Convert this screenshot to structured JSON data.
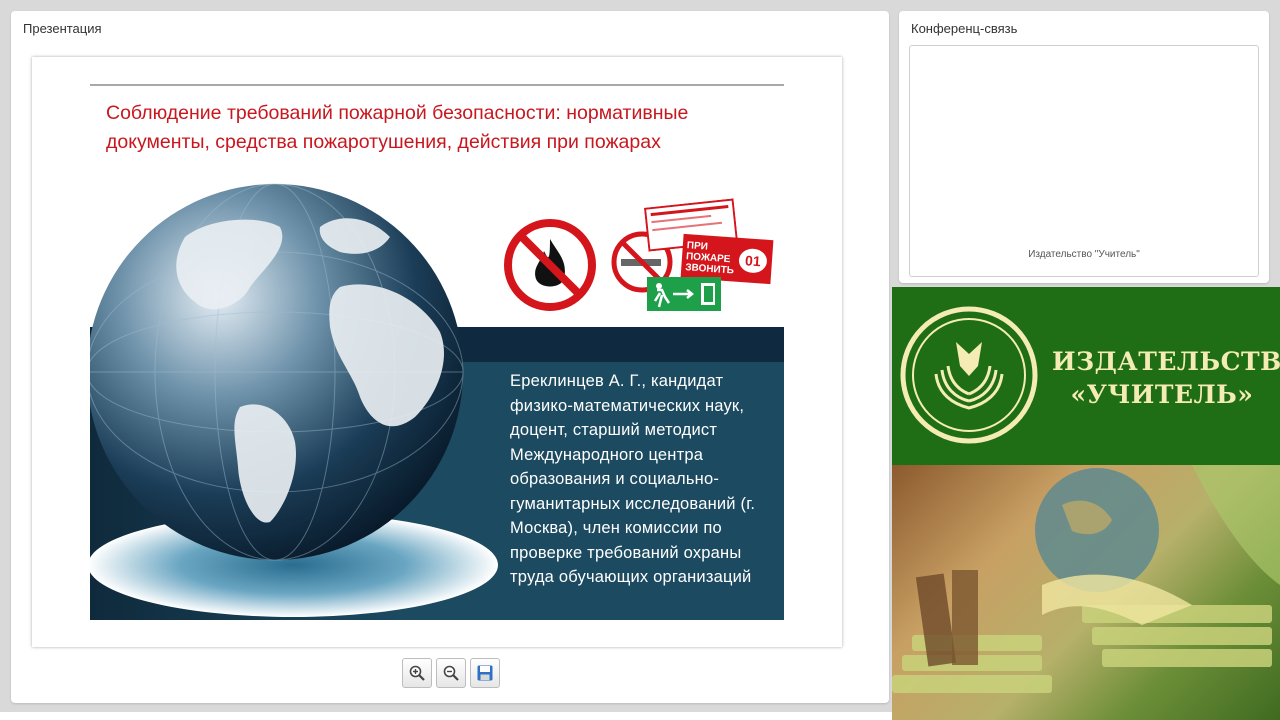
{
  "presentation": {
    "title": "Презентация",
    "slide": {
      "title": "Соблюдение требований пожарной безопасности: нормативные документы, средства пожаротушения, действия при пожарах",
      "bio": "Ереклинцев А. Г., кандидат физико-математических наук, доцент, старший методист Международного центра образования и социально-гуманитарных исследований (г. Москва), член комиссии по проверке требований охраны труда обучающих организаций",
      "sign_fire_call": "ПРИ ПОЖАРЕ ЗВОНИТЬ",
      "sign_number": "01",
      "icons": [
        "no-open-fire-sign-icon",
        "no-smoking-sign-icon",
        "fire-safety-responsible-plate-icon",
        "emergency-exit-sign-icon",
        "globe-illustration"
      ]
    },
    "toolbar": {
      "zoom_in": "zoom-in-icon",
      "zoom_out": "zoom-out-icon",
      "save": "save-icon"
    }
  },
  "conference": {
    "title": "Конференц-связь",
    "caption": "Издательство \"Учитель\""
  },
  "publisher": {
    "name_line1": "ИЗДАТЕЛЬСТВО",
    "name_line2": "«УЧИТЕЛЬ»"
  },
  "colors": {
    "title_red": "#c8171e",
    "slide_navy": "#0f2940",
    "slide_teal": "#1c4a60",
    "publisher_green": "#1f6e16",
    "logo_cream": "#f4ecb4"
  }
}
